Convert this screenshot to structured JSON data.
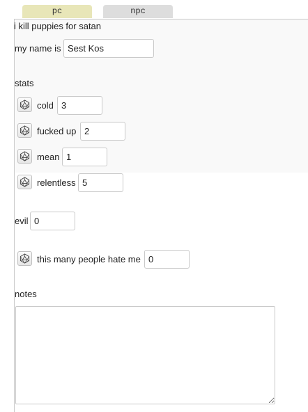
{
  "tabs": [
    {
      "label": "pc"
    },
    {
      "label": "npc"
    }
  ],
  "playbook_title": "i kill puppies for satan",
  "name": {
    "label": "my name is",
    "value": "Sest Kos"
  },
  "stats_heading": "stats",
  "stats": [
    {
      "label": "cold",
      "value": "3"
    },
    {
      "label": "fucked up",
      "value": "2"
    },
    {
      "label": "mean",
      "value": "1"
    },
    {
      "label": "relentless",
      "value": "5"
    }
  ],
  "evil": {
    "label": "evil",
    "value": "0"
  },
  "hate": {
    "label": "this many people hate me",
    "value": "0"
  },
  "notes": {
    "label": "notes",
    "value": ""
  },
  "icons": {
    "roll": "d20-dice-icon"
  }
}
